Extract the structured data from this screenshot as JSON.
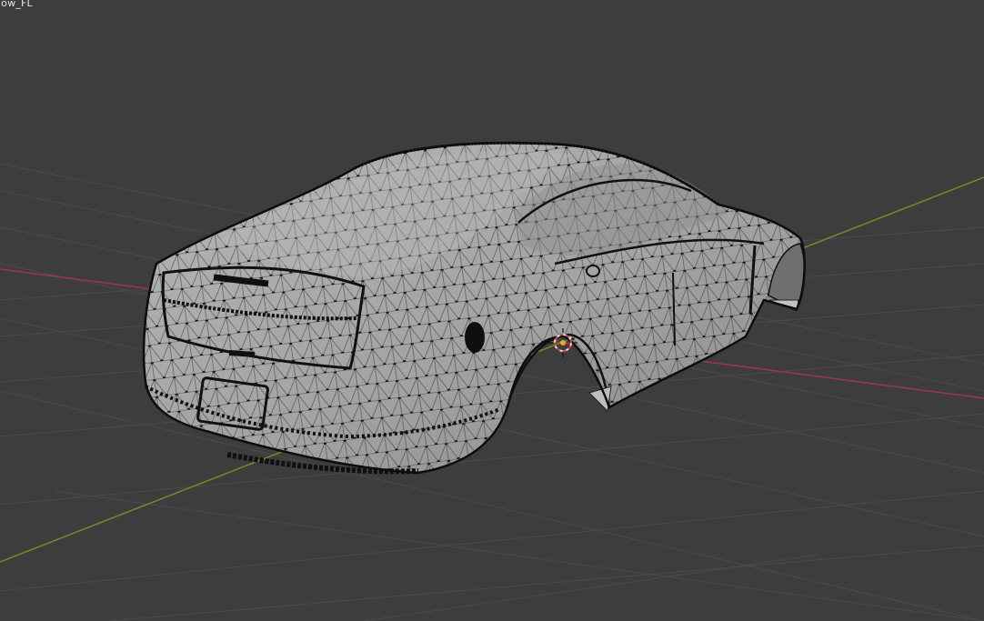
{
  "viewport": {
    "object_label": "dow_FL",
    "background_color": "#3d3d3d",
    "grid_color": "#4a4a4a",
    "x_axis_color": "#9b3a45",
    "y_axis_color": "#6a8f2e",
    "mesh_fill": "#a9a9a9",
    "mesh_shade": "#7d7d7d",
    "wire_color": "#111111",
    "origin_icon": "3d-cursor-icon",
    "mode": "edit-mode-wireframe"
  }
}
